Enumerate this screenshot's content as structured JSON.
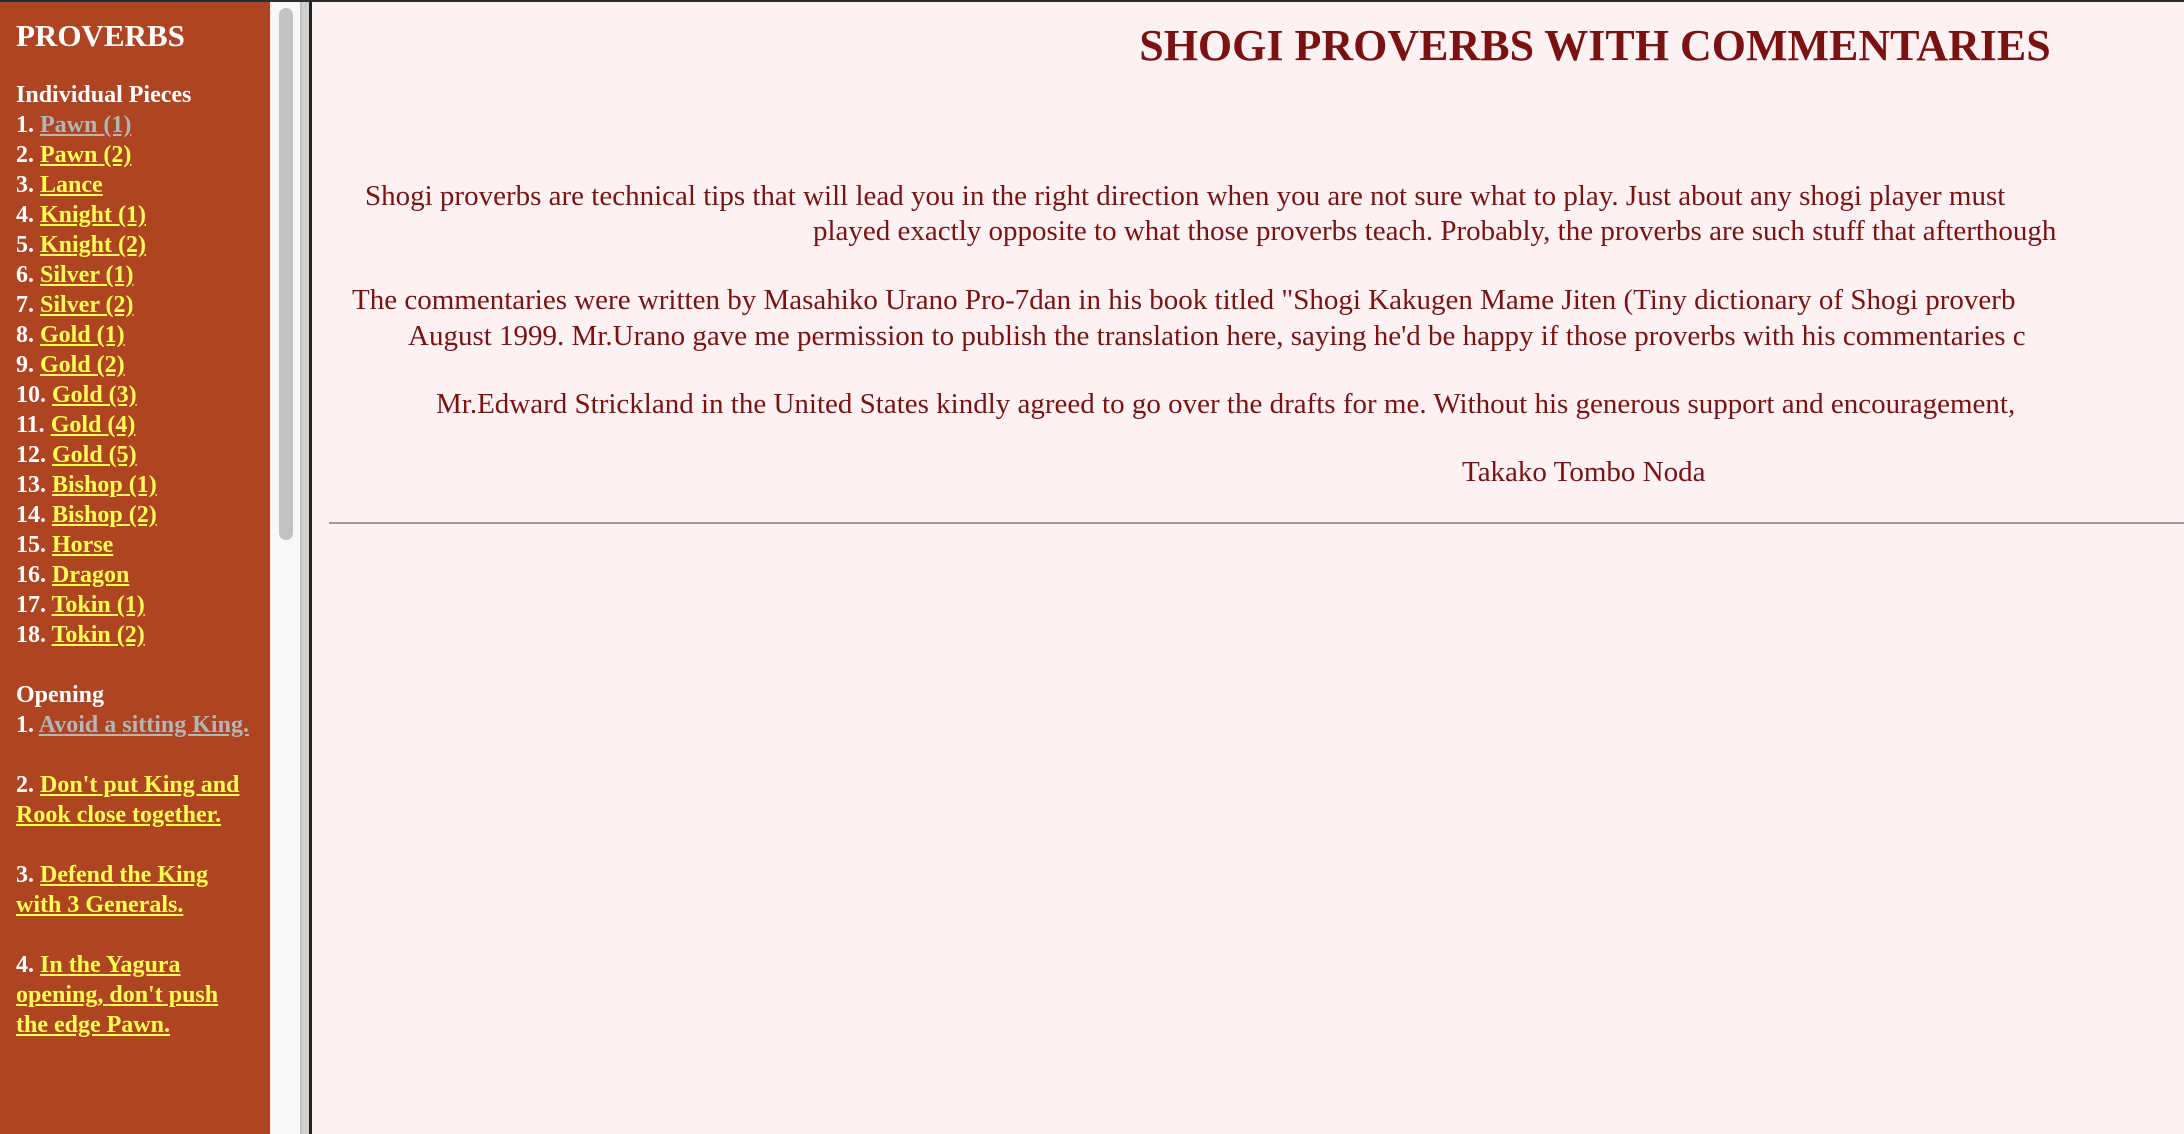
{
  "sidebar": {
    "title": "PROVERBS",
    "sections": [
      {
        "heading": "Individual Pieces",
        "items": [
          {
            "num": "1.",
            "label": "Pawn (1)",
            "visited": true
          },
          {
            "num": "2.",
            "label": "Pawn (2)"
          },
          {
            "num": "3.",
            "label": "Lance"
          },
          {
            "num": "4.",
            "label": "Knight (1)"
          },
          {
            "num": "5.",
            "label": "Knight (2)"
          },
          {
            "num": "6.",
            "label": "Silver (1)"
          },
          {
            "num": "7.",
            "label": "Silver (2)"
          },
          {
            "num": "8.",
            "label": "Gold (1)"
          },
          {
            "num": "9.",
            "label": "Gold (2)"
          },
          {
            "num": "10.",
            "label": "Gold (3)"
          },
          {
            "num": "11.",
            "label": "Gold (4)"
          },
          {
            "num": "12.",
            "label": "Gold (5)"
          },
          {
            "num": "13.",
            "label": "Bishop (1)"
          },
          {
            "num": "14.",
            "label": "Bishop (2)"
          },
          {
            "num": "15.",
            "label": "Horse"
          },
          {
            "num": "16.",
            "label": "Dragon"
          },
          {
            "num": "17.",
            "label": "Tokin (1)"
          },
          {
            "num": "18.",
            "label": "Tokin (2)"
          }
        ]
      },
      {
        "heading": "Opening",
        "items": [
          {
            "num": "1.",
            "label": "Avoid a sitting King.",
            "visited": true
          },
          {
            "num": "2.",
            "label": "Don't put King and Rook close together."
          },
          {
            "num": "3.",
            "label": "Defend the King with 3 Generals."
          },
          {
            "num": "4.",
            "label": "In the Yagura opening, don't push the edge Pawn."
          }
        ]
      }
    ]
  },
  "main": {
    "title": "SHOGI PROVERBS WITH COMMENTARIES",
    "intro_lines": [
      "Shogi proverbs are technical tips that will lead you in the right direction when you are not sure what to play. Just about any shogi player must",
      "played exactly opposite to what those proverbs teach. Probably, the proverbs are such stuff that afterthough"
    ],
    "commentary_lines": [
      "The commentaries were written by Masahiko Urano Pro-7dan in his book titled \"Shogi Kakugen Mame Jiten (Tiny dictionary of Shogi proverb",
      "August 1999. Mr.Urano gave me permission to publish the translation here, saying he'd be happy if those proverbs with his commentaries c"
    ],
    "thanks_line": "Mr.Edward Strickland in the United States kindly agreed to go over the drafts for me. Without his generous support and encouragement,",
    "signature": "Takako Tombo Noda"
  },
  "colors": {
    "sidebar_bg": "#ae4422",
    "link": "#ffff55",
    "visited_link": "#b5b5b5",
    "main_bg": "#fdf2f3",
    "main_text": "#7b1212"
  }
}
